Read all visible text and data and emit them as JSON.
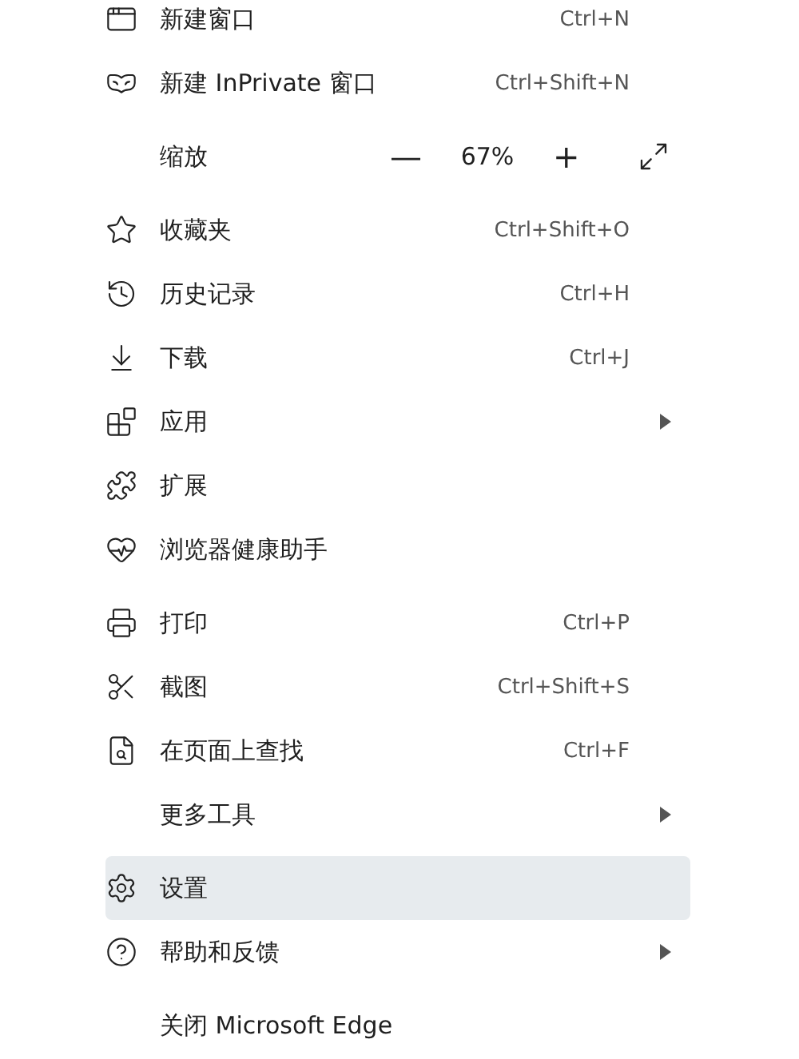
{
  "sections": [
    {
      "items": [
        {
          "kind": "command",
          "label": "新建窗口",
          "shortcut": "Ctrl+N",
          "submenu": false,
          "selected": false
        },
        {
          "kind": "command",
          "label": "新建 InPrivate 窗口",
          "shortcut": "Ctrl+Shift+N",
          "submenu": false,
          "selected": false
        }
      ]
    },
    {
      "items": [
        {
          "kind": "zoom",
          "label": "缩放",
          "minus": "—",
          "value": "67%",
          "plus": "+"
        }
      ]
    },
    {
      "items": [
        {
          "kind": "command",
          "label": "收藏夹",
          "shortcut": "Ctrl+Shift+O",
          "submenu": false,
          "selected": false
        },
        {
          "kind": "command",
          "label": "历史记录",
          "shortcut": "Ctrl+H",
          "submenu": false,
          "selected": false
        },
        {
          "kind": "command",
          "label": "下载",
          "shortcut": "Ctrl+J",
          "submenu": false,
          "selected": false
        },
        {
          "kind": "command",
          "label": "应用",
          "submenu": true,
          "selected": false
        },
        {
          "kind": "command",
          "label": "扩展",
          "submenu": false,
          "selected": false
        },
        {
          "kind": "command",
          "label": "浏览器健康助手",
          "submenu": false,
          "selected": false
        }
      ]
    },
    {
      "items": [
        {
          "kind": "command",
          "label": "打印",
          "shortcut": "Ctrl+P",
          "submenu": false,
          "selected": false
        },
        {
          "kind": "command",
          "label": "截图",
          "shortcut": "Ctrl+Shift+S",
          "submenu": false,
          "selected": false
        },
        {
          "kind": "command",
          "label": "在页面上查找",
          "shortcut": "Ctrl+F",
          "submenu": false,
          "selected": false
        },
        {
          "kind": "command",
          "label": "更多工具",
          "submenu": true,
          "selected": false
        }
      ]
    },
    {
      "items": [
        {
          "kind": "command",
          "label": "设置",
          "submenu": false,
          "selected": true
        },
        {
          "kind": "command",
          "label": "帮助和反馈",
          "submenu": true,
          "selected": false
        }
      ]
    },
    {
      "items": [
        {
          "kind": "command",
          "label": "关闭 Microsoft Edge",
          "submenu": false,
          "selected": false
        }
      ]
    }
  ]
}
